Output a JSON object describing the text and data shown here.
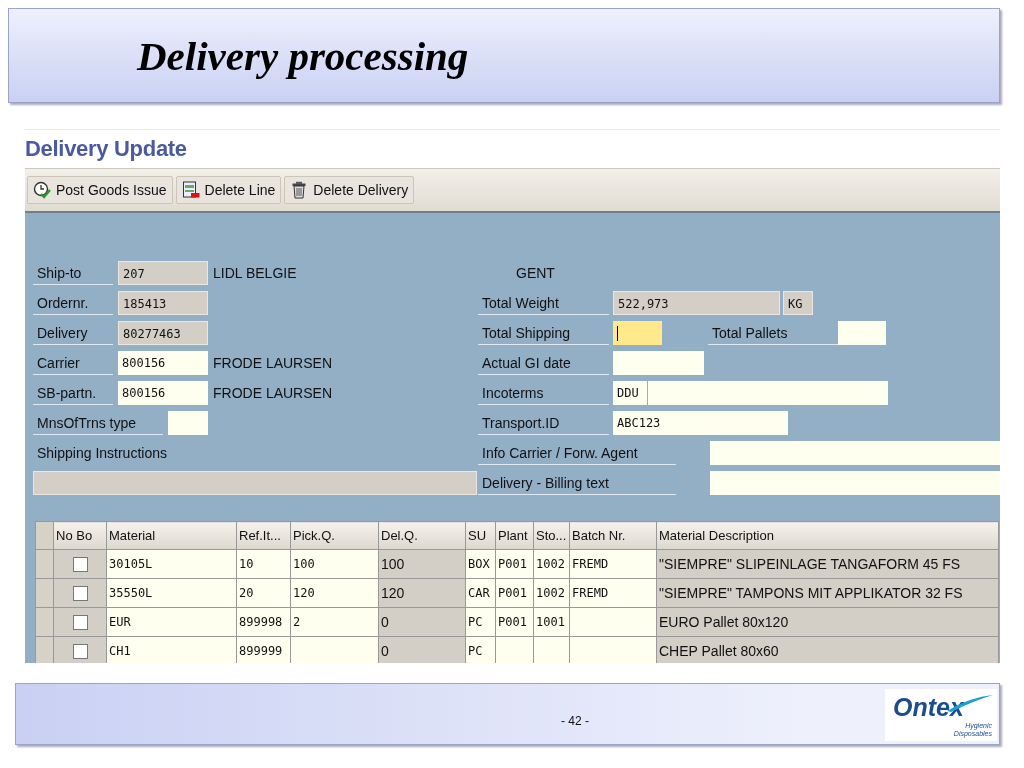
{
  "slide": {
    "title": "Delivery processing",
    "page": "- 42 -",
    "logo": {
      "name": "Ontex",
      "tagline": [
        "Hygienic",
        "Disposables"
      ]
    }
  },
  "screen": {
    "title": "Delivery Update",
    "toolbar": [
      {
        "label": "Post Goods Issue"
      },
      {
        "label": "Delete Line"
      },
      {
        "label": "Delete Delivery"
      }
    ],
    "left_fields": [
      {
        "kind": "field",
        "label": "Ship-to",
        "value": "207",
        "editable": false,
        "description": "LIDL BELGIE"
      },
      {
        "kind": "field",
        "label": "Ordernr.",
        "value": "185413",
        "editable": false
      },
      {
        "kind": "field",
        "label": "Delivery",
        "value": "80277463",
        "editable": false
      },
      {
        "kind": "field",
        "label": "Carrier",
        "value": "800156",
        "editable": true,
        "description": "FRODE LAURSEN"
      },
      {
        "kind": "field",
        "label": "SB-partn.",
        "value": "800156",
        "editable": true,
        "description": "FRODE LAURSEN"
      },
      {
        "kind": "short",
        "label": "MnsOfTrns type",
        "editable": true
      },
      {
        "kind": "heading",
        "label": "Shipping Instructions"
      },
      {
        "kind": "box",
        "editable": false
      }
    ],
    "right_fields": [
      {
        "kind": "city",
        "text": "GENT"
      },
      {
        "kind": "quantity",
        "label": "Total Weight",
        "value": "522,973",
        "unit": "KG"
      },
      {
        "kind": "pair",
        "label": "Total Shipping",
        "focused": true,
        "label_2": "Total Pallets"
      },
      {
        "kind": "date",
        "label": "Actual GI date"
      },
      {
        "kind": "code",
        "label": "Incoterms",
        "value": "DDU"
      },
      {
        "kind": "id",
        "label": "Transport.ID",
        "value": "ABC123"
      },
      {
        "kind": "text",
        "label": "Info Carrier / Forw. Agent"
      },
      {
        "kind": "text",
        "label": "Delivery - Billing text"
      }
    ],
    "table": {
      "columns": [
        {
          "label": "No Bo",
          "kind": "checkbox",
          "editable": false
        },
        {
          "label": "Material",
          "kind": "mono",
          "editable": true
        },
        {
          "label": "Ref.It...",
          "kind": "mono",
          "editable": true
        },
        {
          "label": "Pick.Q.",
          "kind": "mono",
          "editable": true
        },
        {
          "label": "Del.Q.",
          "kind": "text",
          "editable": false
        },
        {
          "label": "SU",
          "kind": "mono",
          "editable": true
        },
        {
          "label": "Plant",
          "kind": "mono",
          "editable": true
        },
        {
          "label": "Sto...",
          "kind": "mono",
          "editable": true
        },
        {
          "label": "Batch Nr.",
          "kind": "mono",
          "editable": true
        },
        {
          "label": "Material Description",
          "kind": "text",
          "editable": false
        }
      ],
      "rows": [
        {
          "cells": [
            {
              "checked": false
            },
            "30105L",
            "10",
            "100",
            "100",
            "BOX",
            "P001",
            "1002",
            "FREMD",
            "\"SIEMPRE\" SLIPEINLAGE TANGAFORM 45 FS"
          ]
        },
        {
          "cells": [
            {
              "checked": false
            },
            "35550L",
            "20",
            "120",
            "120",
            "CAR",
            "P001",
            "1002",
            "FREMD",
            "\"SIEMPRE\" TAMPONS MIT APPLIKATOR 32 FS"
          ]
        },
        {
          "cells": [
            {
              "checked": false
            },
            "EUR",
            "899998",
            "2",
            "0",
            "PC",
            "P001",
            "1001",
            "",
            "EURO Pallet 80x120"
          ]
        },
        {
          "cells": [
            {
              "checked": false
            },
            "CH1",
            "899999",
            "",
            "0",
            "PC",
            "",
            "",
            "",
            "CHEP Pallet 80x60"
          ]
        }
      ]
    }
  }
}
